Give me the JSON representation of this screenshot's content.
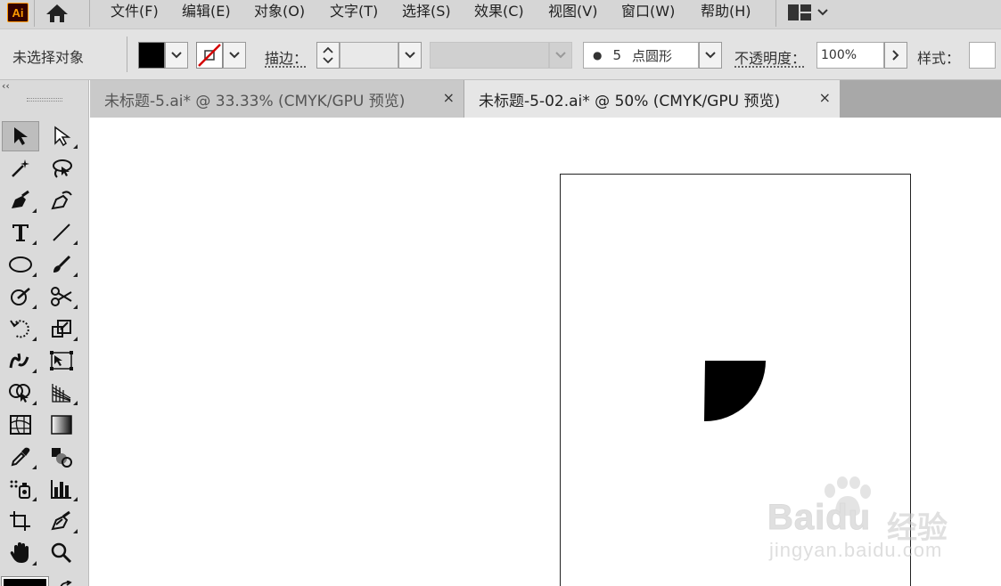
{
  "app": {
    "logo_text": "Ai"
  },
  "menu": {
    "items": [
      {
        "label": "文件(F)"
      },
      {
        "label": "编辑(E)"
      },
      {
        "label": "对象(O)"
      },
      {
        "label": "文字(T)"
      },
      {
        "label": "选择(S)"
      },
      {
        "label": "效果(C)"
      },
      {
        "label": "视图(V)"
      },
      {
        "label": "窗口(W)"
      },
      {
        "label": "帮助(H)"
      }
    ]
  },
  "control_bar": {
    "selection_status": "未选择对象",
    "fill_color": "#000000",
    "stroke_label": "描边：",
    "brush_dot": "●",
    "brush_value": "5",
    "brush_name": "点圆形",
    "opacity_label": "不透明度：",
    "opacity_value": "100%",
    "style_label": "样式："
  },
  "tabs": [
    {
      "label": "未标题-5.ai* @ 33.33% (CMYK/GPU 预览)",
      "active": false,
      "close": "×"
    },
    {
      "label": "未标题-5-02.ai* @ 50% (CMYK/GPU 预览)",
      "active": true,
      "close": "×"
    }
  ],
  "toolbar": {
    "collapse": "‹‹",
    "tools": [
      "selection-tool",
      "direct-selection-tool",
      "magic-wand-tool",
      "lasso-tool",
      "pen-tool",
      "curvature-tool",
      "type-tool",
      "line-segment-tool",
      "ellipse-tool",
      "paintbrush-tool",
      "shaper-tool",
      "scissors-tool",
      "rotate-tool",
      "scale-tool",
      "warp-tool",
      "free-transform-tool",
      "shape-builder-tool",
      "perspective-grid-tool",
      "mesh-tool",
      "gradient-tool",
      "eyedropper-tool",
      "blend-tool",
      "symbol-sprayer-tool",
      "column-graph-tool",
      "artboard-tool",
      "slice-tool",
      "hand-tool",
      "zoom-tool"
    ]
  },
  "canvas": {
    "shape_color": "#000000"
  },
  "watermark": {
    "brand": "Baidu",
    "cn": "经验",
    "url": "jingyan.baidu.com"
  }
}
